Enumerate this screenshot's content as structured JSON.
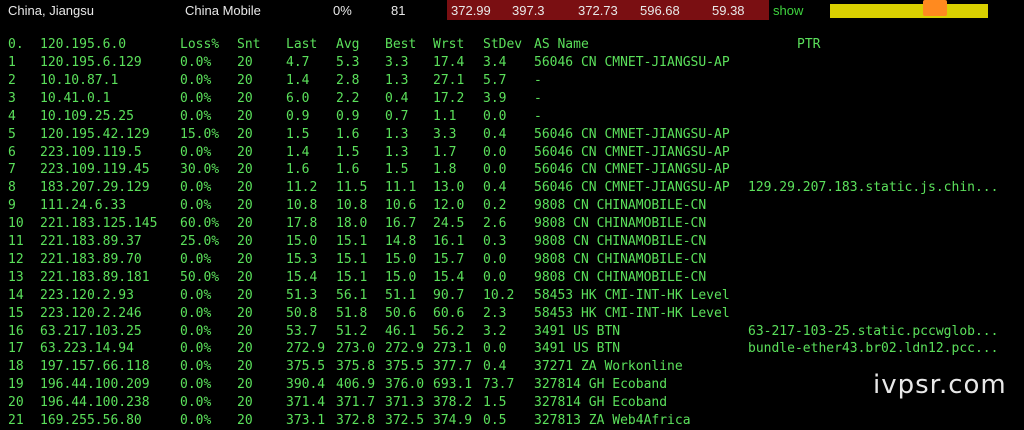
{
  "topbar": {
    "location": "China, Jiangsu",
    "isp": "China Mobile",
    "loss": "0%",
    "count": "81",
    "latencies": [
      "372.99",
      "397.3",
      "372.73",
      "596.68",
      "59.38"
    ],
    "show_label": "show"
  },
  "colors": {
    "text_green": "#5be05b",
    "background": "#000000",
    "latency_band": "#7a0f12",
    "bar_yellow": "#d9d000",
    "bar_marker": "#ff8a1f"
  },
  "table": {
    "headers": {
      "hop": "0.",
      "ip": "120.195.6.0",
      "loss": "Loss%",
      "snt": "Snt",
      "last": "Last",
      "avg": "Avg",
      "best": "Best",
      "wrst": "Wrst",
      "stdev": "StDev",
      "as": "AS Name",
      "ptr": "PTR"
    },
    "rows": [
      {
        "hop": "1",
        "ip": "120.195.6.129",
        "loss": "0.0%",
        "snt": "20",
        "last": "4.7",
        "avg": "5.3",
        "best": "3.3",
        "wrst": "17.4",
        "stdev": "3.4",
        "as": "56046 CN CMNET-JIANGSU-AP",
        "ptr": ""
      },
      {
        "hop": "2",
        "ip": "10.10.87.1",
        "loss": "0.0%",
        "snt": "20",
        "last": "1.4",
        "avg": "2.8",
        "best": "1.3",
        "wrst": "27.1",
        "stdev": "5.7",
        "as": "-",
        "ptr": ""
      },
      {
        "hop": "3",
        "ip": "10.41.0.1",
        "loss": "0.0%",
        "snt": "20",
        "last": "6.0",
        "avg": "2.2",
        "best": "0.4",
        "wrst": "17.2",
        "stdev": "3.9",
        "as": "-",
        "ptr": ""
      },
      {
        "hop": "4",
        "ip": "10.109.25.25",
        "loss": "0.0%",
        "snt": "20",
        "last": "0.9",
        "avg": "0.9",
        "best": "0.7",
        "wrst": "1.1",
        "stdev": "0.0",
        "as": "-",
        "ptr": ""
      },
      {
        "hop": "5",
        "ip": "120.195.42.129",
        "loss": "15.0%",
        "snt": "20",
        "last": "1.5",
        "avg": "1.6",
        "best": "1.3",
        "wrst": "3.3",
        "stdev": "0.4",
        "as": "56046 CN CMNET-JIANGSU-AP",
        "ptr": ""
      },
      {
        "hop": "6",
        "ip": "223.109.119.5",
        "loss": "0.0%",
        "snt": "20",
        "last": "1.4",
        "avg": "1.5",
        "best": "1.3",
        "wrst": "1.7",
        "stdev": "0.0",
        "as": "56046 CN CMNET-JIANGSU-AP",
        "ptr": ""
      },
      {
        "hop": "7",
        "ip": "223.109.119.45",
        "loss": "30.0%",
        "snt": "20",
        "last": "1.6",
        "avg": "1.6",
        "best": "1.5",
        "wrst": "1.8",
        "stdev": "0.0",
        "as": "56046 CN CMNET-JIANGSU-AP",
        "ptr": ""
      },
      {
        "hop": "8",
        "ip": "183.207.29.129",
        "loss": "0.0%",
        "snt": "20",
        "last": "11.2",
        "avg": "11.5",
        "best": "11.1",
        "wrst": "13.0",
        "stdev": "0.4",
        "as": "56046 CN CMNET-JIANGSU-AP",
        "ptr": "129.29.207.183.static.js.chin..."
      },
      {
        "hop": "9",
        "ip": "111.24.6.33",
        "loss": "0.0%",
        "snt": "20",
        "last": "10.8",
        "avg": "10.8",
        "best": "10.6",
        "wrst": "12.0",
        "stdev": "0.2",
        "as": "9808 CN CHINAMOBILE-CN",
        "ptr": ""
      },
      {
        "hop": "10",
        "ip": "221.183.125.145",
        "loss": "60.0%",
        "snt": "20",
        "last": "17.8",
        "avg": "18.0",
        "best": "16.7",
        "wrst": "24.5",
        "stdev": "2.6",
        "as": "9808 CN CHINAMOBILE-CN",
        "ptr": ""
      },
      {
        "hop": "11",
        "ip": "221.183.89.37",
        "loss": "25.0%",
        "snt": "20",
        "last": "15.0",
        "avg": "15.1",
        "best": "14.8",
        "wrst": "16.1",
        "stdev": "0.3",
        "as": "9808 CN CHINAMOBILE-CN",
        "ptr": ""
      },
      {
        "hop": "12",
        "ip": "221.183.89.70",
        "loss": "0.0%",
        "snt": "20",
        "last": "15.3",
        "avg": "15.1",
        "best": "15.0",
        "wrst": "15.7",
        "stdev": "0.0",
        "as": "9808 CN CHINAMOBILE-CN",
        "ptr": ""
      },
      {
        "hop": "13",
        "ip": "221.183.89.181",
        "loss": "50.0%",
        "snt": "20",
        "last": "15.4",
        "avg": "15.1",
        "best": "15.0",
        "wrst": "15.4",
        "stdev": "0.0",
        "as": "9808 CN CHINAMOBILE-CN",
        "ptr": ""
      },
      {
        "hop": "14",
        "ip": "223.120.2.93",
        "loss": "0.0%",
        "snt": "20",
        "last": "51.3",
        "avg": "56.1",
        "best": "51.1",
        "wrst": "90.7",
        "stdev": "10.2",
        "as": "58453 HK CMI-INT-HK Level",
        "ptr": ""
      },
      {
        "hop": "15",
        "ip": "223.120.2.246",
        "loss": "0.0%",
        "snt": "20",
        "last": "50.8",
        "avg": "51.8",
        "best": "50.6",
        "wrst": "60.6",
        "stdev": "2.3",
        "as": "58453 HK CMI-INT-HK Level",
        "ptr": ""
      },
      {
        "hop": "16",
        "ip": "63.217.103.25",
        "loss": "0.0%",
        "snt": "20",
        "last": "53.7",
        "avg": "51.2",
        "best": "46.1",
        "wrst": "56.2",
        "stdev": "3.2",
        "as": "3491 US BTN",
        "ptr": "63-217-103-25.static.pccwglob..."
      },
      {
        "hop": "17",
        "ip": "63.223.14.94",
        "loss": "0.0%",
        "snt": "20",
        "last": "272.9",
        "avg": "273.0",
        "best": "272.9",
        "wrst": "273.1",
        "stdev": "0.0",
        "as": "3491 US BTN",
        "ptr": "bundle-ether43.br02.ldn12.pcc..."
      },
      {
        "hop": "18",
        "ip": "197.157.66.118",
        "loss": "0.0%",
        "snt": "20",
        "last": "375.5",
        "avg": "375.8",
        "best": "375.5",
        "wrst": "377.7",
        "stdev": "0.4",
        "as": "37271 ZA Workonline",
        "ptr": ""
      },
      {
        "hop": "19",
        "ip": "196.44.100.209",
        "loss": "0.0%",
        "snt": "20",
        "last": "390.4",
        "avg": "406.9",
        "best": "376.0",
        "wrst": "693.1",
        "stdev": "73.7",
        "as": "327814 GH Ecoband",
        "ptr": ""
      },
      {
        "hop": "20",
        "ip": "196.44.100.238",
        "loss": "0.0%",
        "snt": "20",
        "last": "371.4",
        "avg": "371.7",
        "best": "371.3",
        "wrst": "378.2",
        "stdev": "1.5",
        "as": "327814 GH Ecoband",
        "ptr": ""
      },
      {
        "hop": "21",
        "ip": "169.255.56.80",
        "loss": "0.0%",
        "snt": "20",
        "last": "373.1",
        "avg": "372.8",
        "best": "372.5",
        "wrst": "374.9",
        "stdev": "0.5",
        "as": "327813 ZA Web4Africa",
        "ptr": ""
      }
    ]
  },
  "watermark": "ivpsr.com"
}
